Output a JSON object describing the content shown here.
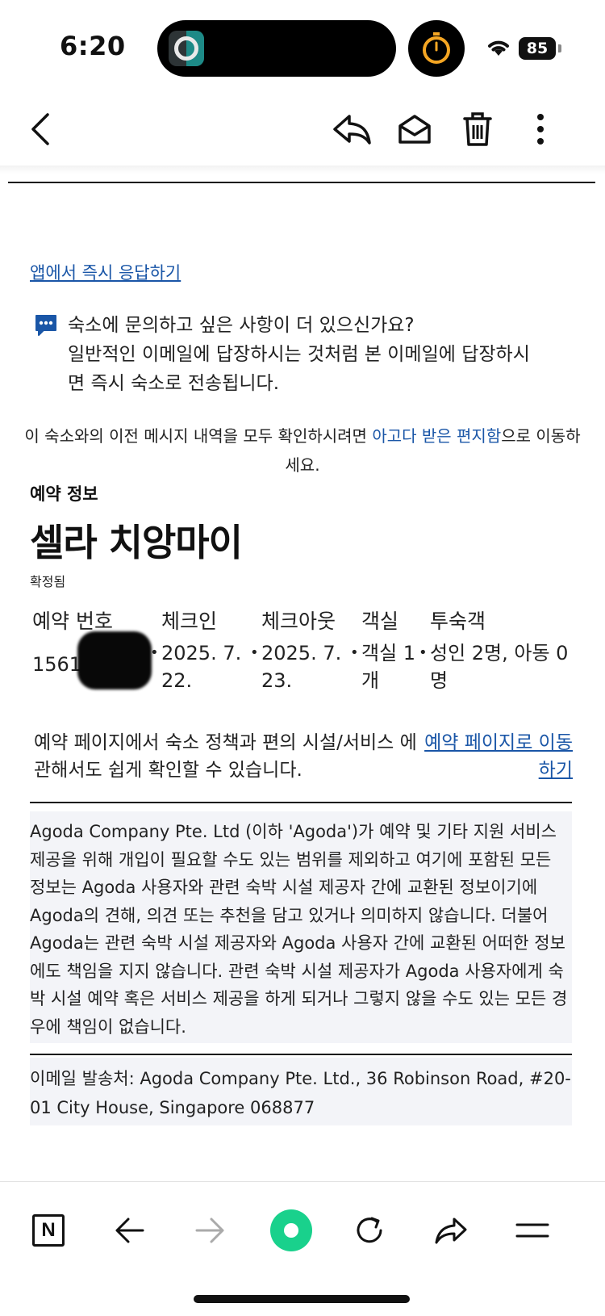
{
  "status_bar": {
    "time": "6:20",
    "battery": "85"
  },
  "mail_toolbar": {
    "icons": [
      "back-chevron-icon",
      "reply-icon",
      "mark-unread-icon",
      "trash-icon",
      "more-vertical-icon"
    ]
  },
  "email": {
    "app_reply_link": "앱에서 즉시 응답하기",
    "question_lines": [
      "숙소에 문의하고 싶은 사항이 더 있으신가요?",
      "일반적인 이메일에 답장하시는 것처럼 본 이메일에 답장하시",
      "면 즉시 숙소로 전송됩니다."
    ],
    "prev_msg_before": "이 숙소와의 이전 메시지 내역을 모두 확인하시려면 ",
    "prev_msg_link": "아고다 받은 편지함",
    "prev_msg_after": "으로 이동하세요.",
    "section_label": "예약 정보",
    "hotel_name": "셀라 치앙마이",
    "booking_status": "확정됨",
    "booking_columns": [
      {
        "header": "예약 번호",
        "value": "15610"
      },
      {
        "header": "체크인",
        "value": "2025. 7. 22."
      },
      {
        "header": "체크아웃",
        "value": "2025. 7. 23."
      },
      {
        "header": "객실",
        "value": "객실 1 개"
      },
      {
        "header": "투숙객",
        "value": "성인 2명, 아동 0명"
      }
    ],
    "bullet": "•",
    "page_info": "예약 페이지에서 숙소 정책과 편의 시설/서비스 에 관해서도 쉽게 확인할 수 있습니다.",
    "page_link": "예약 페이지로 이동하기",
    "disclaimer": "Agoda Company Pte. Ltd (이하 'Agoda')가 예약 및 기타 지원 서비스 제공을 위해 개입이 필요할 수도 있는 범위를 제외하고 여기에 포함된 모든 정보는 Agoda 사용자와 관련 숙박 시설 제공자 간에 교환된 정보이기에 Agoda의 견해, 의견 또는 추천을 담고 있거나 의미하지 않습니다. 더불어 Agoda는 관련 숙박 시설 제공자와 Agoda 사용자 간에 교환된 어떠한 정보에도 책임을 지지 않습니다. 관련 숙박 시설 제공자가 Agoda 사용자에게 숙박 시설 예약 혹은 서비스 제공을 하게 되거나 그렇지 않을 수도 있는 모든 경우에 책임이 없습니다.",
    "sender": "이메일 발송처: Agoda Company Pte. Ltd., 36 Robinson Road, #20-01 City House, Singapore 068877"
  },
  "browser_bar": {
    "icons": [
      "naver-n-icon",
      "back-arrow-icon",
      "forward-arrow-icon",
      "green-home-icon",
      "refresh-icon",
      "share-icon",
      "menu-icon"
    ],
    "naver_letter": "N",
    "accent_color": "#19d18c"
  }
}
